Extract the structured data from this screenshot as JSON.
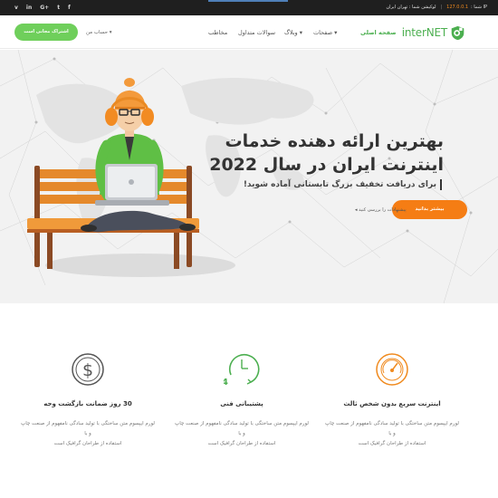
{
  "topbar": {
    "social": [
      "v",
      "in",
      "G+",
      "t",
      "f"
    ],
    "ip_label": "IP شما :",
    "ip_value": "127.0.0.1",
    "location_label": "لوکیشن شما : تهران ایران"
  },
  "header": {
    "logo_text": "interNET",
    "nav": [
      {
        "label": "صفحه اصلی",
        "active": true
      },
      {
        "label": "صفحات ▾",
        "active": false
      },
      {
        "label": "وبلاگ ▾",
        "active": false
      },
      {
        "label": "سوالات متداول",
        "active": false
      },
      {
        "label": "مخاطب",
        "active": false
      }
    ],
    "account": "حساب من ▾",
    "trial_button": "اشتراک مجانی است"
  },
  "hero": {
    "title_line1": "بهترین ارائه دهنده خدمات",
    "title_line2": "اینترنت ایران در سال 2022",
    "subtitle": "برای دریافت تخفیف بزرگ تابستانی آماده شوید!",
    "more_button": "بیشتر بدانید",
    "offers_link": "◂ پیشنهادات را بررسی کنید"
  },
  "features": [
    {
      "icon": "speedometer-icon",
      "title": "اینترنت سریع بدون شخص ثالث",
      "text_line1": "لورم ایپسوم متن ساختگی با تولید سادگی نامفهوم از صنعت چاپ و با",
      "text_line2": "استفاده از طراحان گرافیک است",
      "color": "#f08a1e"
    },
    {
      "icon": "clock-24-icon",
      "title": "پشتیبانی فنی",
      "text_line1": "لورم ایپسوم متن ساختگی با تولید سادگی نامفهوم از صنعت چاپ و با",
      "text_line2": "استفاده از طراحان گرافیک است",
      "color": "#4caf50"
    },
    {
      "icon": "dollar-coin-icon",
      "title": "30 روز ضمانت بازگشت وجه",
      "text_line1": "لورم ایپسوم متن ساختگی با تولید سادگی نامفهوم از صنعت چاپ و با",
      "text_line2": "استفاده از طراحان گرافیک است",
      "color": "#555555"
    }
  ],
  "colors": {
    "accent_green": "#6fcf5b",
    "accent_orange": "#f57d14",
    "topbar": "#1f1f1f"
  }
}
